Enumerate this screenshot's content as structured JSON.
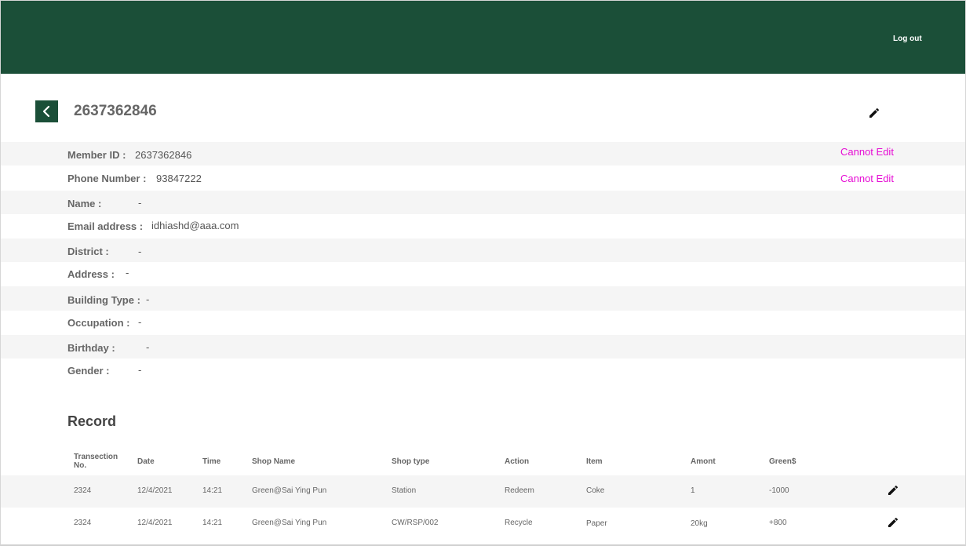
{
  "header": {
    "logout_label": "Log out"
  },
  "page": {
    "title": "2637362846"
  },
  "member": {
    "fields": [
      {
        "label": "Member ID :",
        "value": "2637362846",
        "note": "Cannot Edit"
      },
      {
        "label": "Phone Number :",
        "value": "93847222",
        "note": "Cannot Edit"
      },
      {
        "label": "Name :",
        "value": "-"
      },
      {
        "label": "Email address :",
        "value": "idhiashd@aaa.com"
      },
      {
        "label": "District :",
        "value": "-"
      },
      {
        "label": "Address :",
        "value": "-"
      },
      {
        "label": "Building Type :",
        "value": "-"
      },
      {
        "label": "Occupation :",
        "value": "-"
      },
      {
        "label": "Birthday :",
        "value": "-"
      },
      {
        "label": "Gender :",
        "value": "-"
      }
    ]
  },
  "record": {
    "title": "Record",
    "columns": [
      "Transection No.",
      "Date",
      "Time",
      "Shop Name",
      "Shop type",
      "Action",
      "Item",
      "Amont",
      "Green$"
    ],
    "rows": [
      [
        "2324",
        "12/4/2021",
        "14:21",
        "Green@Sai Ying Pun",
        "Station",
        "Redeem",
        "Coke",
        "1",
        "-1000"
      ],
      [
        "2324",
        "12/4/2021",
        "14:21",
        "Green@Sai Ying Pun",
        "CW/RSP/002",
        "Recycle",
        "Paper",
        "20kg",
        "+800"
      ]
    ]
  },
  "icons": {
    "back": "chevron-left-icon",
    "edit": "pencil-icon"
  },
  "colors": {
    "brand": "#1b4f38",
    "cannot_edit": "#e60cd4",
    "row_shade": "#f5f5f5"
  }
}
